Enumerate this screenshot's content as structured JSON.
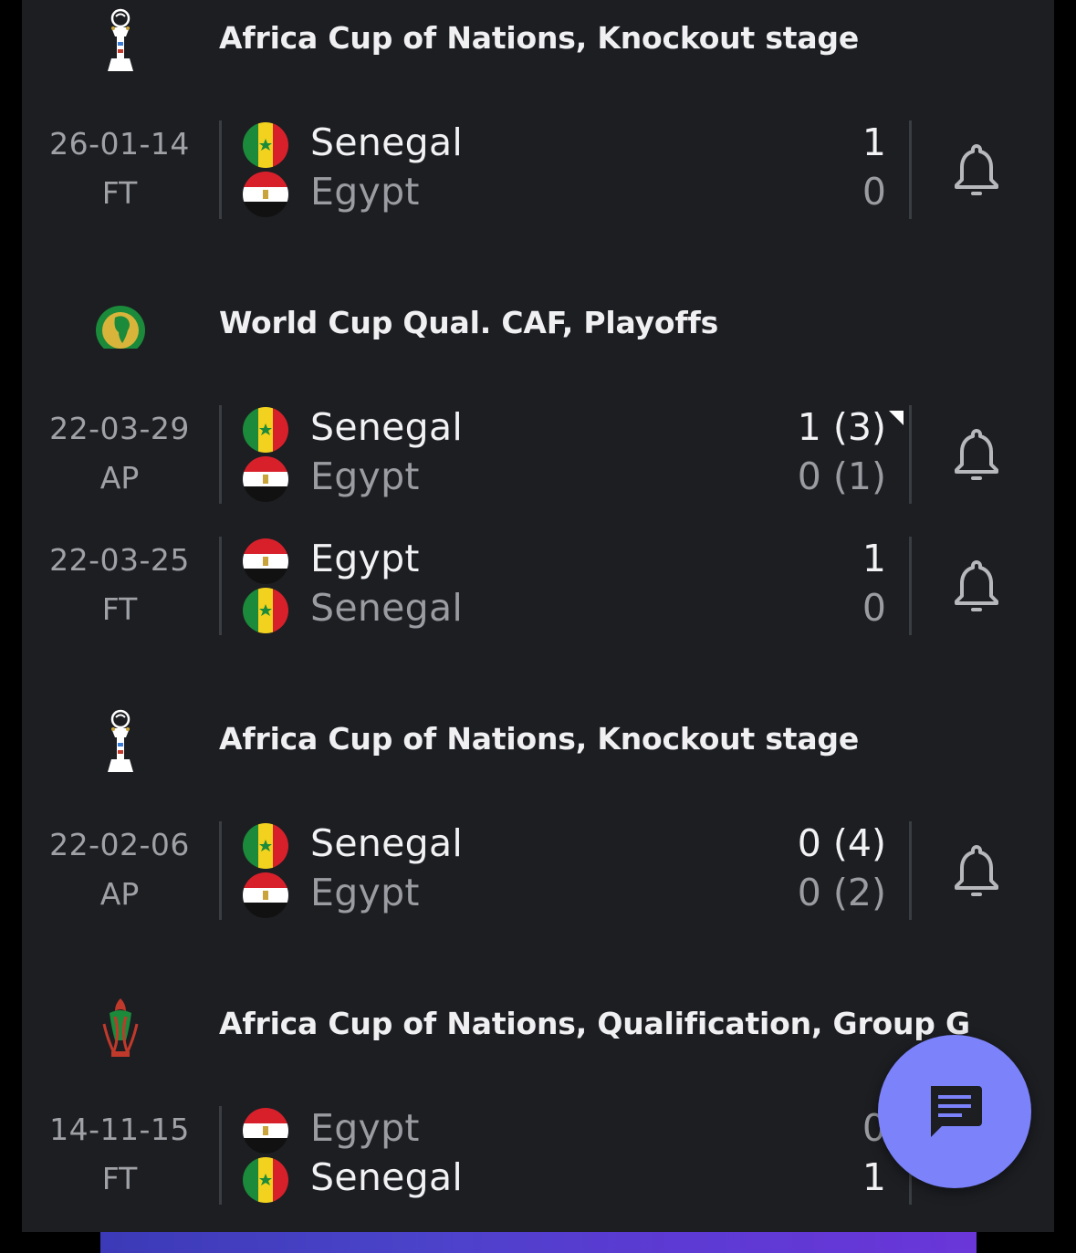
{
  "sections": [
    {
      "league": "Africa Cup of Nations, Knockout stage",
      "league_icon": "afcon-trophy-icon",
      "matches": [
        {
          "date": "26-01-14",
          "status": "FT",
          "home": {
            "name": "Senegal",
            "flag": "senegal-flag-icon",
            "score": "1",
            "winner": true
          },
          "away": {
            "name": "Egypt",
            "flag": "egypt-flag-icon",
            "score": "0",
            "winner": false
          }
        }
      ]
    },
    {
      "league": "World Cup Qual. CAF, Playoffs",
      "league_icon": "caf-logo-icon",
      "matches": [
        {
          "date": "22-03-29",
          "status": "AP",
          "home": {
            "name": "Senegal",
            "flag": "senegal-flag-icon",
            "score": "1 (3)",
            "winner": true
          },
          "away": {
            "name": "Egypt",
            "flag": "egypt-flag-icon",
            "score": "0 (1)",
            "winner": false
          }
        },
        {
          "date": "22-03-25",
          "status": "FT",
          "home": {
            "name": "Egypt",
            "flag": "egypt-flag-icon",
            "score": "1",
            "winner": true
          },
          "away": {
            "name": "Senegal",
            "flag": "senegal-flag-icon",
            "score": "0",
            "winner": false
          }
        }
      ]
    },
    {
      "league": "Africa Cup of Nations, Knockout stage",
      "league_icon": "afcon-trophy-icon",
      "matches": [
        {
          "date": "22-02-06",
          "status": "AP",
          "home": {
            "name": "Senegal",
            "flag": "senegal-flag-icon",
            "score": "0 (4)",
            "winner": true
          },
          "away": {
            "name": "Egypt",
            "flag": "egypt-flag-icon",
            "score": "0 (2)",
            "winner": false
          }
        }
      ]
    },
    {
      "league": "Africa Cup of Nations, Qualification, Group G",
      "league_icon": "afcon-qualification-icon",
      "matches": [
        {
          "date": "14-11-15",
          "status": "FT",
          "home": {
            "name": "Egypt",
            "flag": "egypt-flag-icon",
            "score": "0",
            "winner": false
          },
          "away": {
            "name": "Senegal",
            "flag": "senegal-flag-icon",
            "score": "1",
            "winner": true
          }
        }
      ]
    }
  ],
  "notification_icon": "bell-icon",
  "chat_button_icon": "chat-icon",
  "colors": {
    "background": "#1c1e22",
    "winner_text": "#f2f2f4",
    "loser_text": "#9a9ca1",
    "fab": "#7b82fa"
  }
}
